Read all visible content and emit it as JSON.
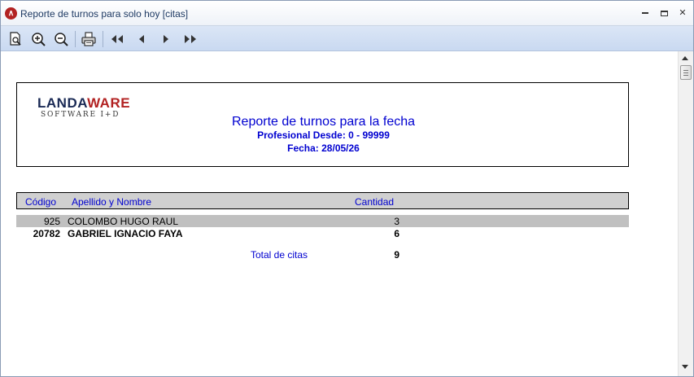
{
  "window": {
    "title": "Reporte de turnos para solo hoy [citas]",
    "app_icon": "landaware-app-icon",
    "controls": [
      "minimize",
      "maximize",
      "close"
    ]
  },
  "toolbar": {
    "buttons": [
      {
        "name": "page-preview",
        "icon": "page-zoom-icon"
      },
      {
        "name": "zoom-in",
        "icon": "zoom-in-icon"
      },
      {
        "name": "zoom-out",
        "icon": "zoom-out-icon"
      },
      {
        "name": "print",
        "icon": "printer-icon"
      },
      {
        "name": "first-page",
        "icon": "double-left-arrow-icon"
      },
      {
        "name": "previous-page",
        "icon": "left-arrow-icon"
      },
      {
        "name": "next-page",
        "icon": "right-arrow-icon"
      },
      {
        "name": "last-page",
        "icon": "double-right-arrow-icon"
      }
    ]
  },
  "report": {
    "logo": {
      "brand_land": "LANDA",
      "brand_ware": "WARE",
      "tagline": "SOFTWARE I+D"
    },
    "title": "Reporte de turnos para la fecha",
    "professional_range": "Profesional Desde: 0 - 99999",
    "date": "Fecha: 28/05/26",
    "columns": {
      "code": "Código",
      "name": "Apellido y Nombre",
      "quantity": "Cantidad"
    },
    "rows": [
      {
        "code": "925",
        "name": "COLOMBO HUGO RAUL",
        "quantity": "3"
      },
      {
        "code": "20782",
        "name": "GABRIEL IGNACIO FAYA",
        "quantity": "6"
      }
    ],
    "total": {
      "label": "Total de citas",
      "value": "9"
    }
  },
  "colors": {
    "accent_blue": "#0000d0",
    "brand_red": "#b22222",
    "brand_navy": "#1a2a55",
    "row_highlight": "#c0c0c0",
    "toolbar_bg": "#c9d9f1"
  }
}
